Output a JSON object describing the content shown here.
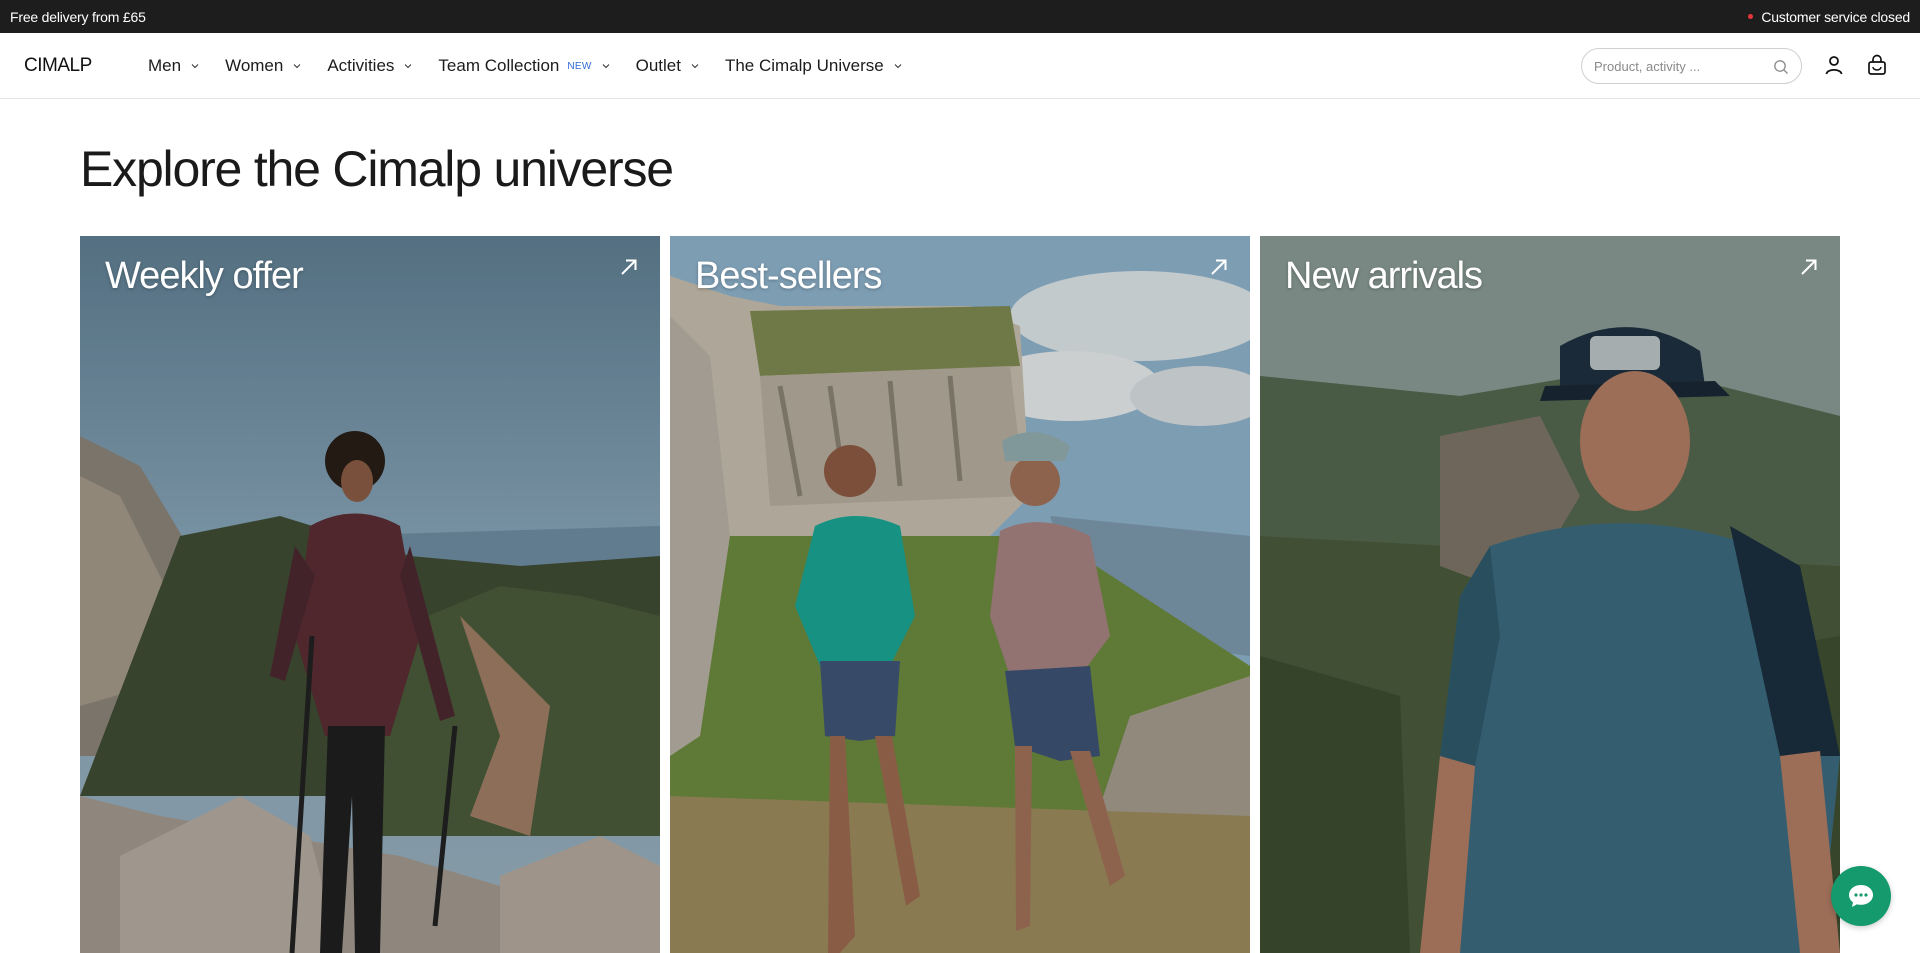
{
  "topbar": {
    "promo": "Free delivery from £65",
    "status": "Customer service closed",
    "status_color": "#e8353b"
  },
  "header": {
    "logo": "CIMALP",
    "nav": [
      {
        "label": "Men",
        "badge": ""
      },
      {
        "label": "Women",
        "badge": ""
      },
      {
        "label": "Activities",
        "badge": ""
      },
      {
        "label": "Team Collection",
        "badge": "NEW"
      },
      {
        "label": "Outlet",
        "badge": ""
      },
      {
        "label": "The Cimalp Universe",
        "badge": ""
      }
    ],
    "search": {
      "placeholder": "Product, activity ..."
    },
    "icons": {
      "search": "search-icon",
      "account": "user-icon",
      "cart": "bag-icon"
    }
  },
  "main": {
    "title": "Explore the Cimalp universe",
    "cards": [
      {
        "label": "Weekly offer",
        "icon": "arrow-up-right-icon"
      },
      {
        "label": "Best-sellers",
        "icon": "arrow-up-right-icon"
      },
      {
        "label": "New arrivals",
        "icon": "arrow-up-right-icon"
      }
    ]
  },
  "chat": {
    "icon": "chat-bubble-icon",
    "color": "#149a6c"
  }
}
